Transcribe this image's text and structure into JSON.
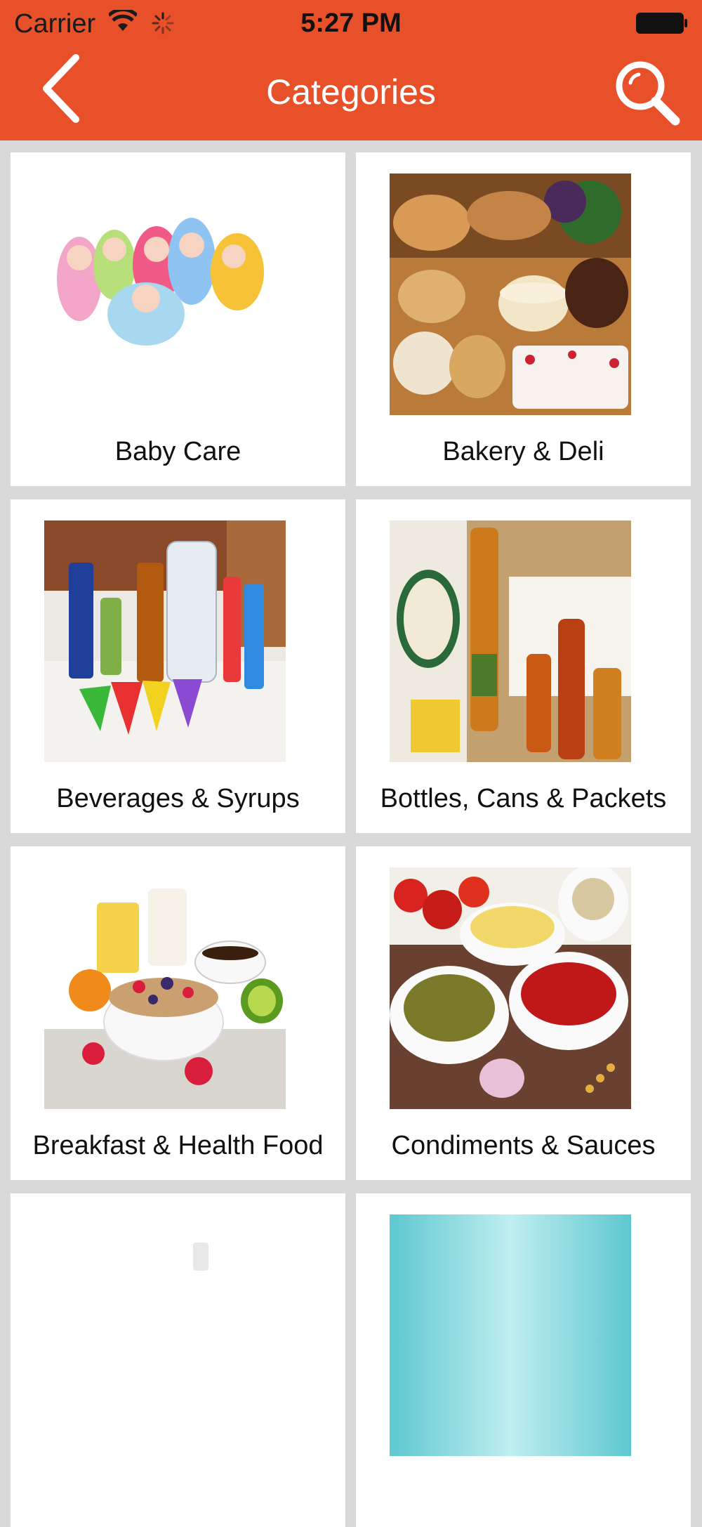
{
  "status_bar": {
    "carrier": "Carrier",
    "time": "5:27 PM"
  },
  "nav": {
    "title": "Categories",
    "back_icon": "chevron-left-icon",
    "search_icon": "search-icon"
  },
  "colors": {
    "header": "#e8502a",
    "background": "#d9d9d9",
    "card": "#ffffff"
  },
  "categories": [
    {
      "label": "Baby Care"
    },
    {
      "label": "Bakery & Deli"
    },
    {
      "label": "Beverages & Syrups"
    },
    {
      "label": "Bottles, Cans & Packets"
    },
    {
      "label": "Breakfast & Health Food"
    },
    {
      "label": "Condiments & Sauces"
    },
    {
      "label": ""
    },
    {
      "label": ""
    }
  ]
}
